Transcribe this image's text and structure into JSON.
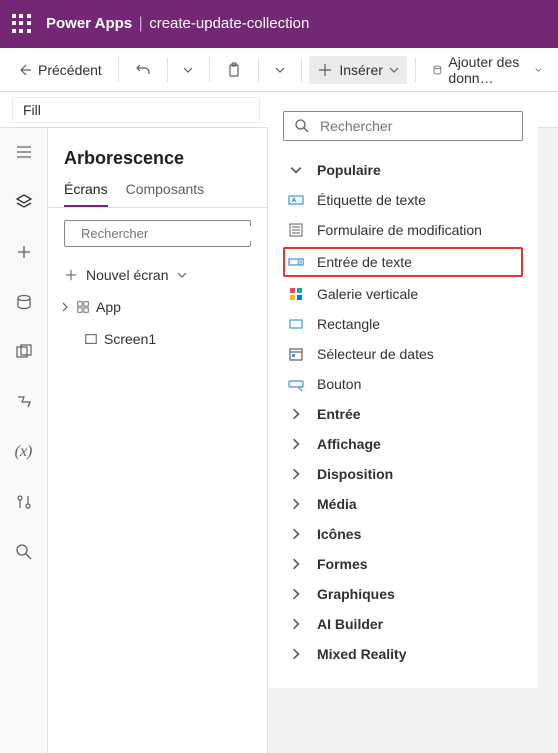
{
  "header": {
    "product": "Power Apps",
    "appName": "create-update-collection"
  },
  "cmdBar": {
    "back": "Précédent",
    "insert": "Insérer",
    "addData": "Ajouter des donn…"
  },
  "formula": {
    "property": "Fill"
  },
  "tree": {
    "title": "Arborescence",
    "tabs": {
      "screens": "Écrans",
      "components": "Composants"
    },
    "searchPlaceholder": "Rechercher",
    "newScreen": "Nouvel écran",
    "items": {
      "root": "App",
      "screen1": "Screen1"
    }
  },
  "insertPanel": {
    "searchPlaceholder": "Rechercher",
    "popular": {
      "label": "Populaire",
      "items": {
        "label": "Étiquette de texte",
        "editForm": "Formulaire de modification",
        "textInput": "Entrée de texte",
        "gallery": "Galerie verticale",
        "rectangle": "Rectangle",
        "datePicker": "Sélecteur de dates",
        "button": "Bouton"
      }
    },
    "categories": {
      "input": "Entrée",
      "display": "Affichage",
      "layout": "Disposition",
      "media": "Média",
      "icons": "Icônes",
      "shapes": "Formes",
      "charts": "Graphiques",
      "ai": "AI Builder",
      "mixed": "Mixed Reality"
    }
  }
}
